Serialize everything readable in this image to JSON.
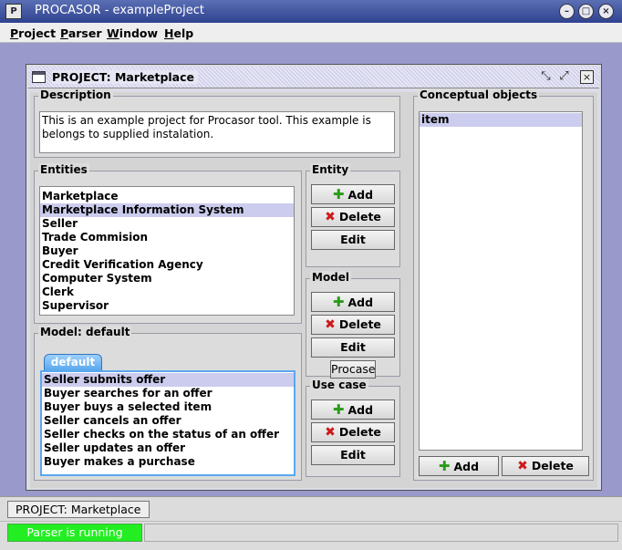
{
  "window": {
    "title": "PROCASOR - exampleProject",
    "app_icon": "procasor-logo"
  },
  "menubar": {
    "items": [
      "Project",
      "Parser",
      "Window",
      "Help"
    ]
  },
  "frame": {
    "title": "PROJECT: Marketplace",
    "description": {
      "label": "Description",
      "text": "This is an example project for Procasor tool. This example is belongs to supplied instalation."
    },
    "entities": {
      "label": "Entities",
      "items": [
        "Marketplace",
        "Marketplace Information System",
        "Seller",
        "Trade Commision",
        "Buyer",
        "Credit Verification Agency",
        "Computer System",
        "Clerk",
        "Supervisor"
      ],
      "selected_index": 1
    },
    "entity_group": {
      "label": "Entity",
      "add": "Add",
      "delete": "Delete",
      "edit": "Edit"
    },
    "model_group": {
      "label": "Model",
      "add": "Add",
      "delete": "Delete",
      "edit": "Edit",
      "procase": "Procase"
    },
    "usecase_group": {
      "label": "Use case",
      "add": "Add",
      "delete": "Delete",
      "edit": "Edit"
    },
    "model": {
      "label": "Model: default",
      "tab": "default",
      "items": [
        "Seller submits offer",
        "Buyer searches for an offer",
        "Buyer buys a selected item",
        "Seller cancels an offer",
        "Seller checks on the status of an offer",
        "Seller updates an offer",
        "Buyer makes a purchase"
      ],
      "selected_index": 0
    },
    "conceptual": {
      "label": "Conceptual objects",
      "items": [
        "item"
      ],
      "add": "Add",
      "delete": "Delete"
    }
  },
  "taskbar": {
    "item": "PROJECT: Marketplace"
  },
  "status": {
    "message": "Parser is running",
    "color": "#22ee22"
  }
}
